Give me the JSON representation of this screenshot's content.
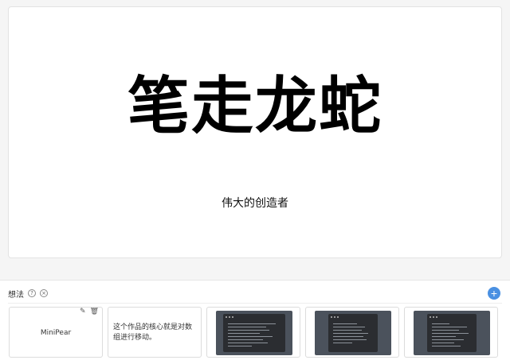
{
  "slide": {
    "title": "笔走龙蛇",
    "subtitle": "伟大的创造者"
  },
  "panel": {
    "title": "想法",
    "help_icon": "?",
    "close_icon": "×",
    "add_label": "+"
  },
  "cards": [
    {
      "label": "MiniPear",
      "edit_icon": "✎",
      "delete_icon": "🗑"
    },
    {
      "text": "这个作品的核心就是对数组进行移动。"
    },
    {
      "type": "code-screenshot"
    },
    {
      "type": "code-screenshot"
    },
    {
      "type": "code-screenshot"
    }
  ],
  "colors": {
    "accent": "#4a90e2",
    "thumb_bg": "#4b525c",
    "code_bg": "#2b2d31"
  }
}
